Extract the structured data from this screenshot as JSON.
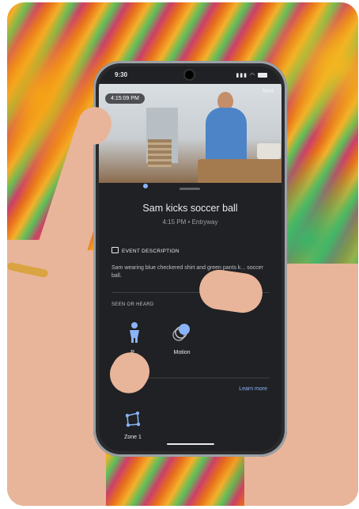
{
  "status_bar": {
    "time": "9:30",
    "system_icons": [
      "signal-icon",
      "wifi-icon",
      "battery-icon"
    ]
  },
  "camera_feed": {
    "timestamp": "4:15:09 PM",
    "brand": "Nest"
  },
  "event": {
    "title": "Sam kicks soccer ball",
    "time": "4:15 PM",
    "location": "Entryway",
    "separator": "•"
  },
  "description": {
    "heading": "EVENT DESCRIPTION",
    "text": "Sam wearing blue checkered shirt and green pants k... soccer ball."
  },
  "seen_or_heard": {
    "heading": "SEEN OR HEARD",
    "items": [
      {
        "label": "P...",
        "icon": "person-icon"
      },
      {
        "label": "Motion",
        "icon": "motion-icon"
      }
    ],
    "learn_more": "Learn more"
  },
  "zones": {
    "items": [
      {
        "label": "Zone 1",
        "icon": "zone-icon"
      }
    ]
  },
  "colors": {
    "background": "#202124",
    "accent": "#8ab4f8",
    "text": "#e8eaed",
    "muted": "#9aa0a6"
  }
}
